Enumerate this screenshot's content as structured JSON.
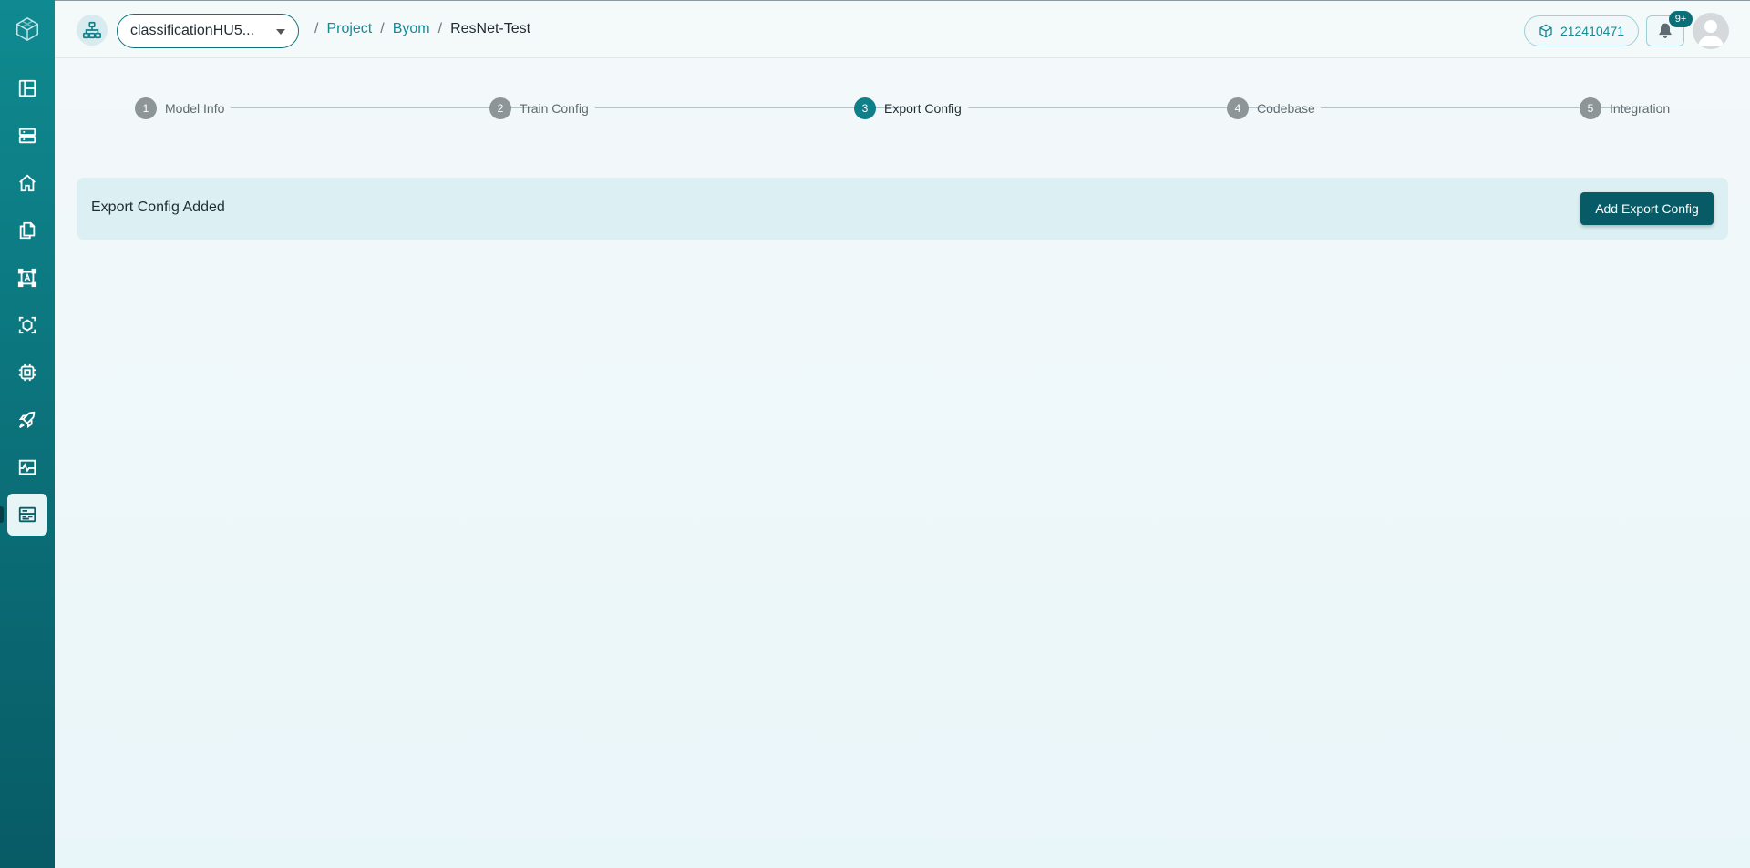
{
  "sidebar": {
    "logo_icon": "cube-logo-icon",
    "items": [
      {
        "icon": "dashboard-icon"
      },
      {
        "icon": "storage-icon"
      },
      {
        "icon": "home-icon"
      },
      {
        "icon": "copy-icon"
      },
      {
        "icon": "annotate-icon"
      },
      {
        "icon": "model-icon"
      },
      {
        "icon": "chip-icon"
      },
      {
        "icon": "rocket-icon"
      },
      {
        "icon": "monitor-icon"
      },
      {
        "icon": "byom-icon",
        "active": true
      }
    ]
  },
  "header": {
    "project_select": {
      "value": "classificationHU5..."
    },
    "breadcrumb": {
      "items": [
        "Project",
        "Byom"
      ],
      "current": "ResNet-Test",
      "separator": "/"
    },
    "credits": "212410471",
    "notifications_badge": "9+"
  },
  "steps": [
    {
      "num": "1",
      "label": "Model Info"
    },
    {
      "num": "2",
      "label": "Train Config"
    },
    {
      "num": "3",
      "label": "Export Config",
      "active": true
    },
    {
      "num": "4",
      "label": "Codebase"
    },
    {
      "num": "5",
      "label": "Integration"
    }
  ],
  "export": {
    "title": "Export Config Added",
    "add_button": "Add Export Config"
  },
  "colors": {
    "accent": "#0b6f78",
    "link": "#178a95",
    "bar_bg": "#dcf0f3"
  }
}
